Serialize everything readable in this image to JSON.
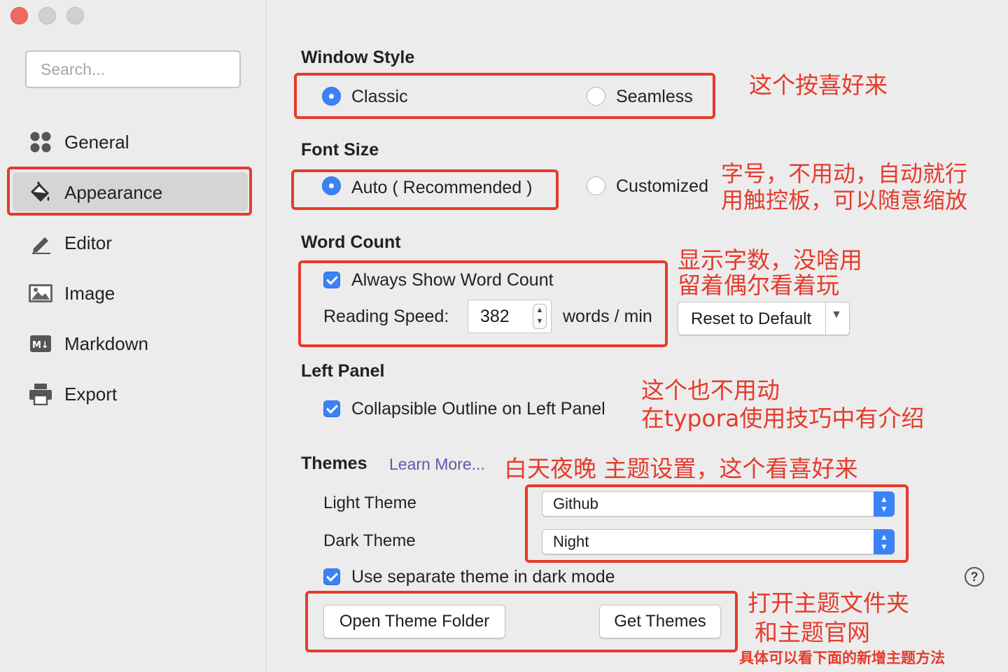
{
  "window": {
    "close": "close",
    "minimize": "minimize",
    "zoom": "zoom"
  },
  "search": {
    "placeholder": "Search..."
  },
  "sidebar": {
    "items": [
      {
        "label": "General",
        "icon": "grid-icon"
      },
      {
        "label": "Appearance",
        "icon": "paint-bucket-icon",
        "selected": true
      },
      {
        "label": "Editor",
        "icon": "pencil-icon"
      },
      {
        "label": "Image",
        "icon": "image-icon"
      },
      {
        "label": "Markdown",
        "icon": "markdown-icon"
      },
      {
        "label": "Export",
        "icon": "printer-icon"
      }
    ]
  },
  "window_style": {
    "title": "Window Style",
    "classic": "Classic",
    "seamless": "Seamless",
    "selected": "Classic"
  },
  "font_size": {
    "title": "Font Size",
    "auto": "Auto ( Recommended )",
    "customized": "Customized",
    "selected": "Auto ( Recommended )"
  },
  "word_count": {
    "title": "Word Count",
    "always_show": "Always Show Word Count",
    "always_show_checked": true,
    "reading_speed_label": "Reading Speed:",
    "reading_speed_value": "382",
    "unit": "words / min",
    "reset": "Reset to Default"
  },
  "left_panel": {
    "title": "Left Panel",
    "collapsible": "Collapsible Outline on Left Panel",
    "collapsible_checked": true
  },
  "themes": {
    "title": "Themes",
    "learn_more": "Learn More...",
    "light_label": "Light Theme",
    "light_value": "Github",
    "dark_label": "Dark Theme",
    "dark_value": "Night",
    "separate": "Use separate theme in dark mode",
    "separate_checked": true,
    "open_folder": "Open Theme Folder",
    "get_themes": "Get Themes",
    "help": "?"
  },
  "annotations": {
    "a1": "这个按喜好来",
    "a2_line1": "字号，不用动，自动就行",
    "a2_line2": "用触控板，可以随意缩放",
    "a3_line1": "显示字数，没啥用",
    "a3_line2": "留着偶尔看着玩",
    "a4_line1": "这个也不用动",
    "a4_line2": "在typora使用技巧中有介绍",
    "a5": "白天夜晚 主题设置，这个看喜好来",
    "a6_line1": "打开主题文件夹",
    "a6_line2": "和主题官网",
    "a7": "具体可以看下面的新增主题方法"
  },
  "colors": {
    "accent": "#3b82f6",
    "annotation": "#e53b2c",
    "link": "#5c5ca8"
  }
}
